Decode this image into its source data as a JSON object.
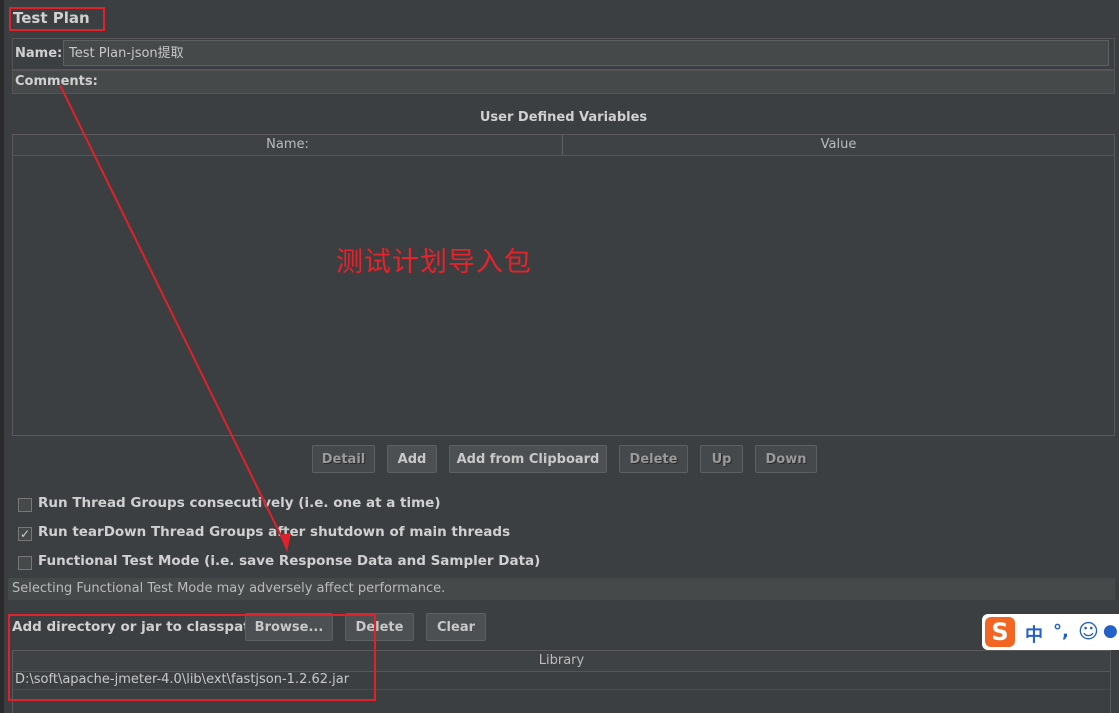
{
  "title": "Test Plan",
  "name_field": {
    "label": "Name:",
    "value": "Test Plan-json提取"
  },
  "comments_label": "Comments:",
  "user_defined_variables": {
    "title": "User Defined Variables",
    "columns": [
      "Name:",
      "Value"
    ]
  },
  "annotation_text": "测试计划导入包",
  "buttons": {
    "detail": "Detail",
    "add": "Add",
    "add_from_clipboard": "Add from Clipboard",
    "delete": "Delete",
    "up": "Up",
    "down": "Down"
  },
  "options": [
    {
      "label": "Run Thread Groups consecutively (i.e. one at a time)",
      "checked": false
    },
    {
      "label": "Run tearDown Thread Groups after shutdown of main threads",
      "checked": true
    },
    {
      "label": "Functional Test Mode (i.e. save Response Data and Sampler Data)",
      "checked": false
    }
  ],
  "info_text": "Selecting Functional Test Mode may adversely affect performance.",
  "classpath": {
    "label": "Add directory or jar to classpath",
    "browse": "Browse...",
    "delete": "Delete",
    "clear": "Clear",
    "column": "Library",
    "rows": [
      "D:\\soft\\apache-jmeter-4.0\\lib\\ext\\fastjson-1.2.62.jar"
    ]
  },
  "ime_toolbar": {
    "logo": "S",
    "mode": "中",
    "punct": "°,",
    "emoji": "☺",
    "mic": "🎤"
  },
  "colors": {
    "background": "#3c3f41",
    "annotation_red": "#e0202a",
    "ime_blue": "#2361c6",
    "ime_orange": "#f26522"
  }
}
